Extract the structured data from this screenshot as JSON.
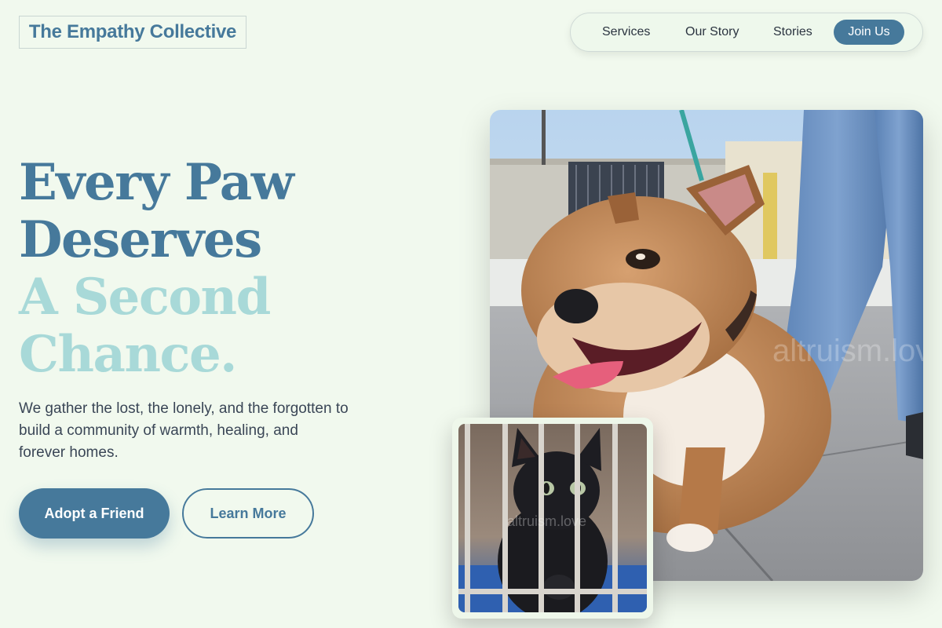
{
  "brand": {
    "name": "The Empathy Collective"
  },
  "nav": {
    "items": [
      {
        "label": "Services"
      },
      {
        "label": "Our Story"
      },
      {
        "label": "Stories"
      }
    ],
    "cta_label": "Join Us"
  },
  "hero": {
    "headline_line1": "Every Paw",
    "headline_line2": "Deserves",
    "headline_line3": "A Second",
    "headline_line4": "Chance.",
    "subtext": "We gather the lost, the lonely, and the forgotten to build a community of warmth, healing, and forever homes.",
    "primary_button": "Adopt a Friend",
    "secondary_button": "Learn More"
  },
  "images": {
    "dog_watermark": "altruism.love",
    "cat_watermark": "altruism.love"
  },
  "colors": {
    "background": "#f1f9ee",
    "primary": "#46799b",
    "accent_light": "#a8d9d8"
  }
}
